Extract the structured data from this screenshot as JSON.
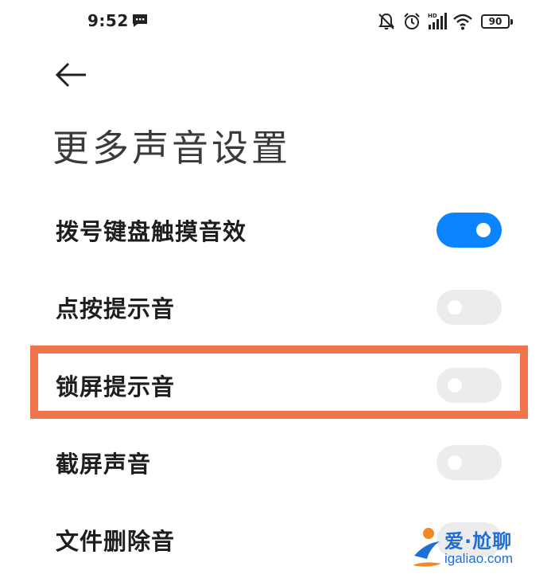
{
  "status_bar": {
    "time": "9:52",
    "battery": "90",
    "icons": [
      "message-icon",
      "mute-bell-icon",
      "alarm-icon",
      "hd-signal-icon",
      "wifi-icon",
      "battery-icon"
    ]
  },
  "header": {
    "back_icon": "back-arrow-icon",
    "title": "更多声音设置"
  },
  "settings": [
    {
      "label": "拨号键盘触摸音效",
      "enabled": true
    },
    {
      "label": "点按提示音",
      "enabled": false
    },
    {
      "label": "锁屏提示音",
      "enabled": false,
      "highlighted": true
    },
    {
      "label": "截屏声音",
      "enabled": false
    },
    {
      "label": "文件删除音",
      "enabled": false
    }
  ],
  "colors": {
    "toggle_on": "#0d84ff",
    "toggle_off": "#ececec",
    "highlight": "#f1744a"
  },
  "watermark": {
    "cn": "爱·尬聊",
    "en": "igaliao.com"
  }
}
